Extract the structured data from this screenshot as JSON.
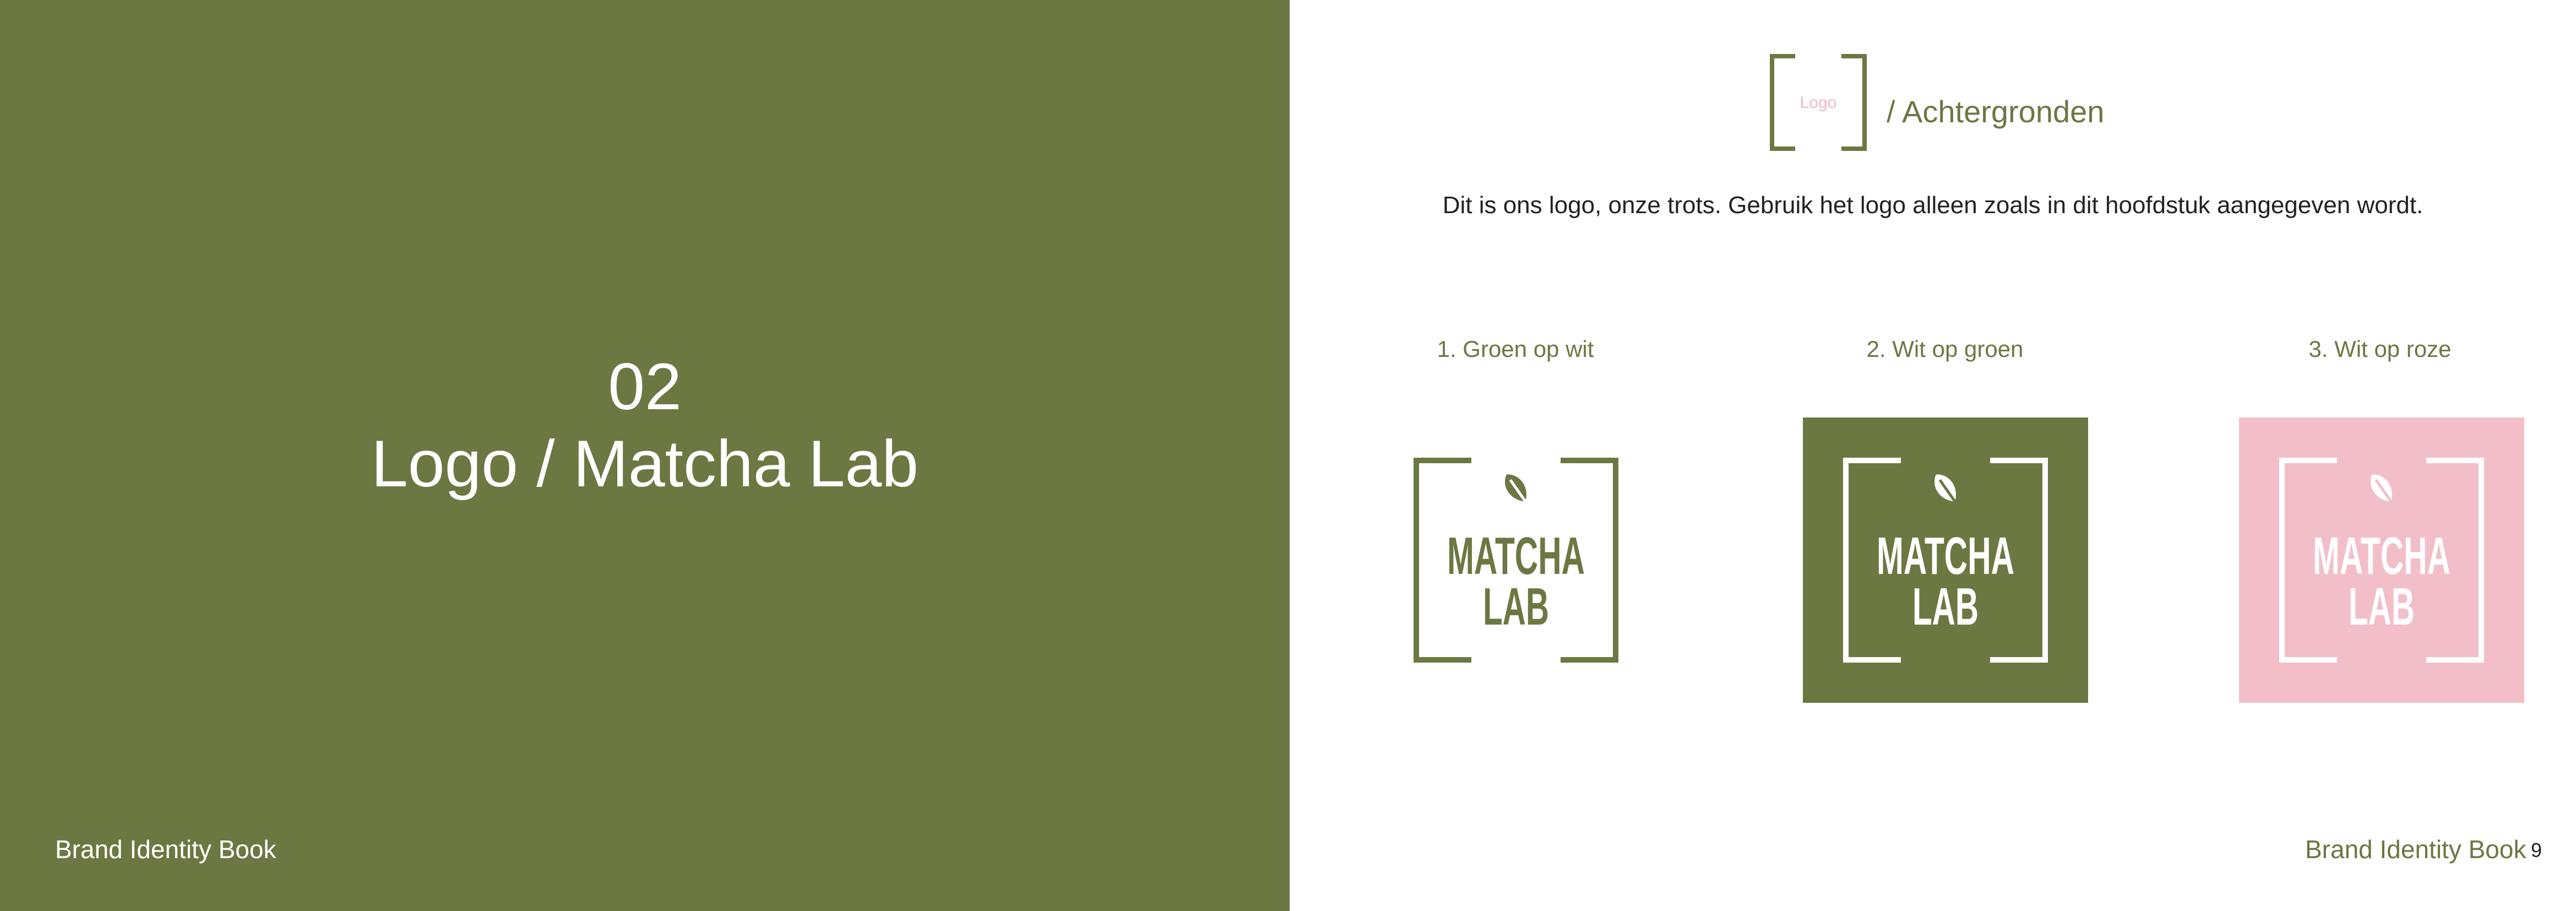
{
  "colors": {
    "green": "#6b7842",
    "pink": "#f2bfc9",
    "white": "#ffffff",
    "text_dark": "#222222",
    "accent_pink_text": "#f2b8c6"
  },
  "left_page": {
    "chapter_number": "02",
    "chapter_title": "Logo / Matcha Lab",
    "footer": "Brand Identity Book"
  },
  "right_page": {
    "header_box_label": "Logo",
    "section_title": "/ Achtergronden",
    "intro": "Dit is ons logo, onze trots. Gebruik het logo alleen zoals in dit hoofdstuk aangegeven wordt.",
    "variants": [
      {
        "label": "1. Groen op wit",
        "background": "#ffffff",
        "foreground": "#6b7842",
        "icon": "leaf-icon"
      },
      {
        "label": "2. Wit op groen",
        "background": "#6b7842",
        "foreground": "#ffffff",
        "icon": "leaf-icon"
      },
      {
        "label": "3. Wit op roze",
        "background": "#f2bfc9",
        "foreground": "#ffffff",
        "icon": "leaf-icon"
      }
    ],
    "logo_wordmark": {
      "line1": "MATCHA",
      "line2": "LAB"
    },
    "footer": "Brand Identity Book",
    "page_number": "9"
  }
}
